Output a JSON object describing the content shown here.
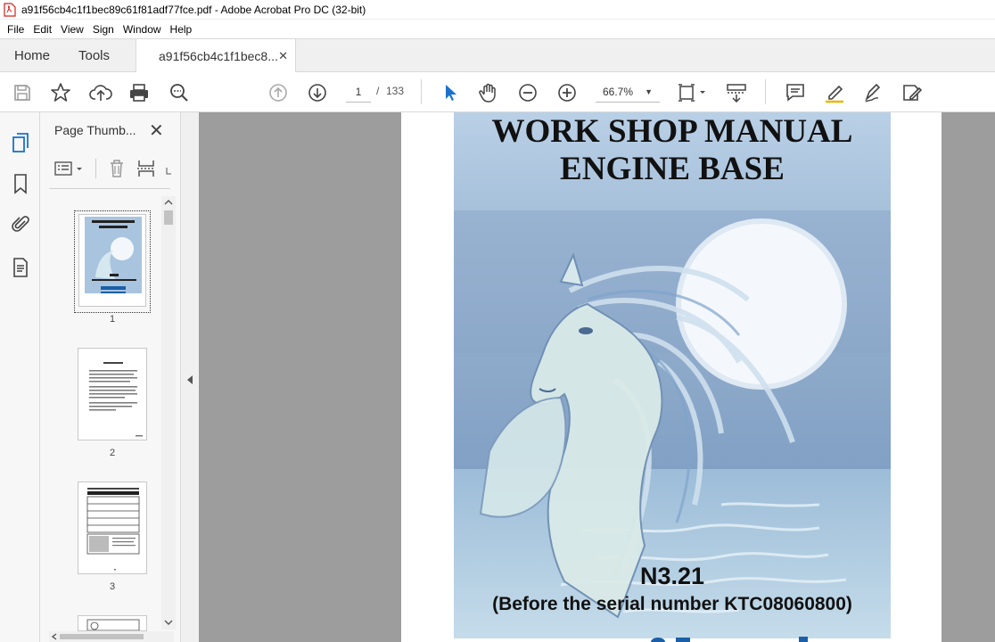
{
  "window": {
    "title": "a91f56cb4c1f1bec89c61f81adf77fce.pdf - Adobe Acrobat Pro DC (32-bit)"
  },
  "menubar": [
    "File",
    "Edit",
    "View",
    "Sign",
    "Window",
    "Help"
  ],
  "tabs": {
    "home": "Home",
    "tools": "Tools",
    "document": "a91f56cb4c1f1bec8...",
    "close_glyph": "✕"
  },
  "toolbar": {
    "current_page": "1",
    "page_separator": "/",
    "page_count": "133",
    "zoom": "66.7%"
  },
  "thumbnail_panel": {
    "title": "Page Thumb...",
    "close_glyph": "✕",
    "thumbnails": [
      {
        "number": "1",
        "selected": true
      },
      {
        "number": "2",
        "selected": false
      },
      {
        "number": "3",
        "selected": false
      }
    ]
  },
  "document": {
    "title_line1": "WORK SHOP MANUAL",
    "title_line2": "ENGINE BASE",
    "model": "N3.21",
    "serial_note": "(Before the serial number KTC08060800)"
  },
  "colors": {
    "accent_blue": "#1a73c9",
    "doc_background": "#9d9d9d",
    "cover_blue": "#a8c4df"
  }
}
